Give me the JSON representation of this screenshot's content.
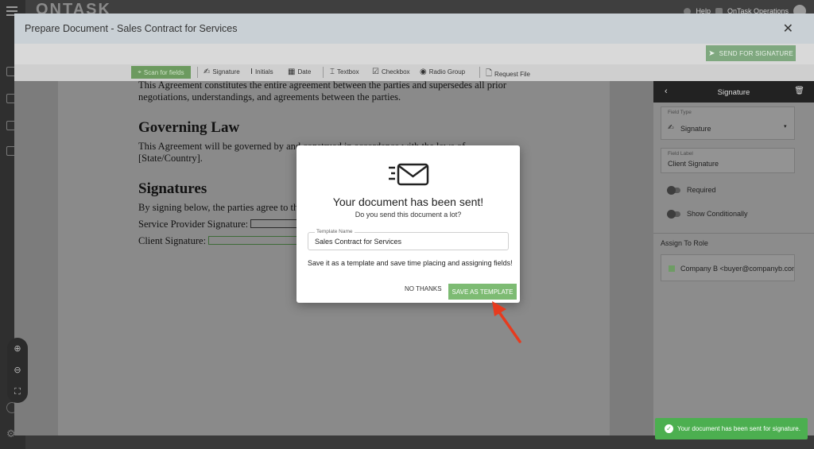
{
  "app": {
    "brand": "ONTASK",
    "help_label": "Help",
    "org_label": "OnTask Operations"
  },
  "dialog": {
    "title": "Prepare Document - Sales Contract for Services",
    "send_label": "SEND FOR SIGNATURE"
  },
  "toolbar": {
    "scan": "Scan for fields",
    "items": [
      "Signature",
      "Initials",
      "Date",
      "Textbox",
      "Checkbox",
      "Radio Group",
      "Request File"
    ]
  },
  "document": {
    "para1_line1": "This Agreement constitutes the entire agreement between the parties and supersedes all prior",
    "para1_line2": "negotiations, understandings, and agreements between the parties.",
    "heading_law": "Governing Law",
    "law_line1": "This Agreement will be governed by and construed in accordance with the laws of",
    "law_line2": "[State/Country].",
    "heading_sig": "Signatures",
    "sig_line": "By signing below, the parties agree to the terms of this Agreement.",
    "provider_label": "Service Provider Signature:",
    "client_label": "Client Signature:"
  },
  "panel": {
    "title": "Signature",
    "field_type_label": "Field Type",
    "field_type_value": "Signature",
    "field_label_label": "Field Label",
    "field_label_value": "Client Signature",
    "required_label": "Required",
    "conditional_label": "Show Conditionally",
    "assign_label": "Assign To Role",
    "role_value": "Company B <buyer@companyb.com"
  },
  "modal": {
    "title": "Your document has been sent!",
    "subtitle": "Do you send this document a lot?",
    "input_label": "Template Name",
    "input_value": "Sales Contract for Services",
    "description": "Save it as a template and save time placing and assigning fields!",
    "no_thanks": "NO THANKS",
    "save_template": "SAVE AS TEMPLATE"
  },
  "toast": {
    "message": "Your document has been sent for signature."
  },
  "colors": {
    "accent_green": "#7dbb73",
    "toast_green": "#4caf50",
    "annotation_red": "#e63b1f"
  }
}
